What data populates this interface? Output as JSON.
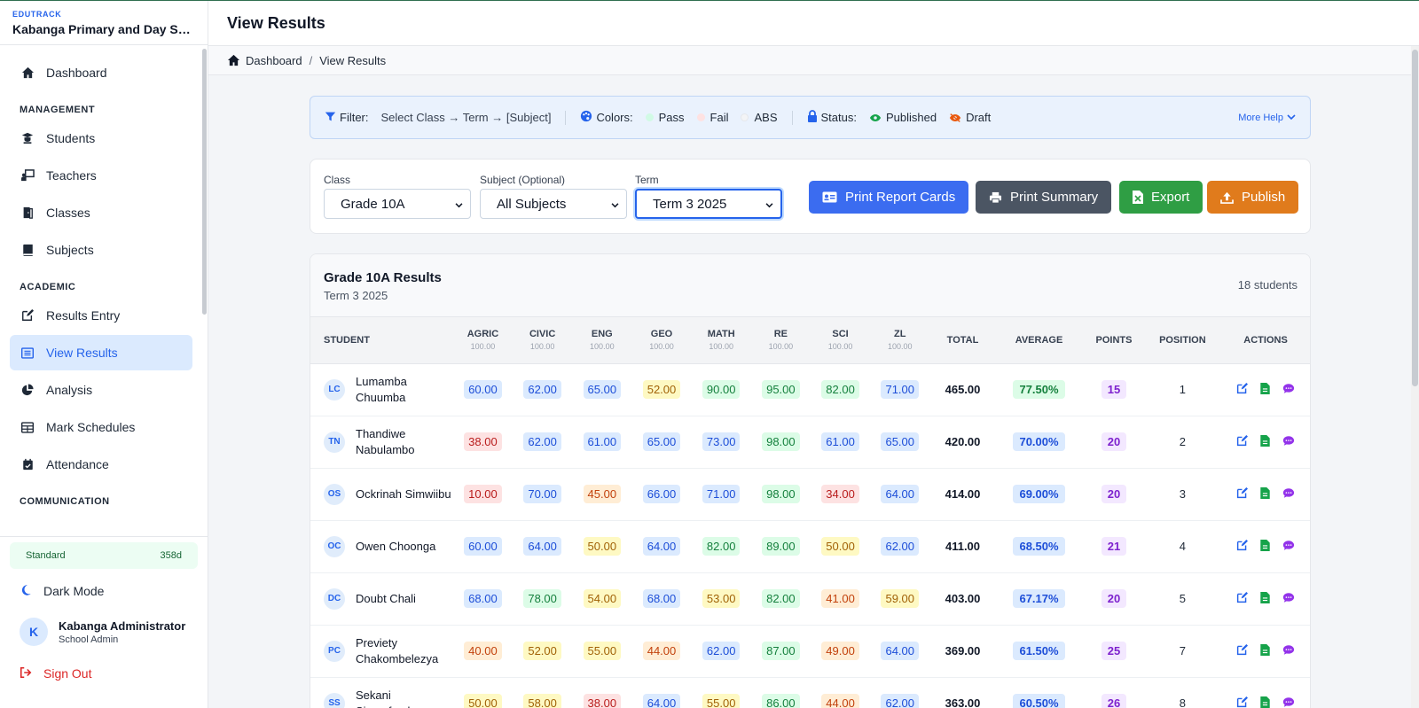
{
  "brand": {
    "tag": "EDUTRACK",
    "school": "Kabanga Primary and Day Sec..."
  },
  "sidebar": {
    "items_top": [
      {
        "label": "Dashboard",
        "icon": "home-icon"
      }
    ],
    "section_management": "MANAGEMENT",
    "items_management": [
      {
        "label": "Students",
        "icon": "student-icon"
      },
      {
        "label": "Teachers",
        "icon": "teacher-icon"
      },
      {
        "label": "Classes",
        "icon": "door-icon"
      },
      {
        "label": "Subjects",
        "icon": "book-icon"
      }
    ],
    "section_academic": "ACADEMIC",
    "items_academic": [
      {
        "label": "Results Entry",
        "icon": "edit-icon"
      },
      {
        "label": "View Results",
        "icon": "list-icon",
        "active": true
      },
      {
        "label": "Analysis",
        "icon": "pie-chart-icon"
      },
      {
        "label": "Mark Schedules",
        "icon": "table-icon"
      },
      {
        "label": "Attendance",
        "icon": "calendar-check-icon"
      }
    ],
    "section_communication": "COMMUNICATION",
    "plan": {
      "name": "Standard",
      "days": "358d"
    },
    "dark_mode": "Dark Mode",
    "user": {
      "initial": "K",
      "name": "Kabanga Administrator",
      "role": "School Admin"
    },
    "sign_out": "Sign Out"
  },
  "header": {
    "title": "View Results"
  },
  "breadcrumb": {
    "home": "Dashboard",
    "current": "View Results"
  },
  "help": {
    "filter_label": "Filter:",
    "filter_text": "Select Class → Term → [Subject]",
    "colors_label": "Colors:",
    "pass": "Pass",
    "fail": "Fail",
    "abs": "ABS",
    "status_label": "Status:",
    "published": "Published",
    "draft": "Draft",
    "more_help": "More Help"
  },
  "filters": {
    "class_label": "Class",
    "class_value": "Grade 10A",
    "subject_label": "Subject (Optional)",
    "subject_value": "All Subjects",
    "term_label": "Term",
    "term_value": "Term 3 2025"
  },
  "buttons": {
    "print_report": "Print Report Cards",
    "print_summary": "Print Summary",
    "export": "Export",
    "publish": "Publish"
  },
  "colors": {
    "blue_btn": "#3b6cf0",
    "gray_btn": "#4b5563",
    "green_btn": "#2f9e44",
    "orange_btn": "#e07b1c"
  },
  "results": {
    "title": "Grade 10A Results",
    "term": "Term 3 2025",
    "count": "18 students",
    "columns": {
      "student": "STUDENT",
      "subjects": [
        "AGRIC",
        "CIVIC",
        "ENG",
        "GEO",
        "MATH",
        "RE",
        "SCI",
        "ZL"
      ],
      "max": "100.00",
      "total": "TOTAL",
      "average": "AVERAGE",
      "points": "POINTS",
      "position": "POSITION",
      "actions": "ACTIONS"
    },
    "rows": [
      {
        "initials": "LC",
        "name": "Lumamba Chuumba",
        "marks": [
          "60.00",
          "62.00",
          "65.00",
          "52.00",
          "90.00",
          "95.00",
          "82.00",
          "71.00"
        ],
        "total": "465.00",
        "average": "77.50%",
        "points": "15",
        "position": "1"
      },
      {
        "initials": "TN",
        "name": "Thandiwe Nabulambo",
        "marks": [
          "38.00",
          "62.00",
          "61.00",
          "65.00",
          "73.00",
          "98.00",
          "61.00",
          "65.00"
        ],
        "total": "420.00",
        "average": "70.00%",
        "points": "20",
        "position": "2"
      },
      {
        "initials": "OS",
        "name": "Ockrinah Simwiibu",
        "marks": [
          "10.00",
          "70.00",
          "45.00",
          "66.00",
          "71.00",
          "98.00",
          "34.00",
          "64.00"
        ],
        "total": "414.00",
        "average": "69.00%",
        "points": "20",
        "position": "3"
      },
      {
        "initials": "OC",
        "name": "Owen Choonga",
        "marks": [
          "60.00",
          "64.00",
          "50.00",
          "64.00",
          "82.00",
          "89.00",
          "50.00",
          "62.00"
        ],
        "total": "411.00",
        "average": "68.50%",
        "points": "21",
        "position": "4"
      },
      {
        "initials": "DC",
        "name": "Doubt Chali",
        "marks": [
          "68.00",
          "78.00",
          "54.00",
          "68.00",
          "53.00",
          "82.00",
          "41.00",
          "59.00"
        ],
        "total": "403.00",
        "average": "67.17%",
        "points": "20",
        "position": "5"
      },
      {
        "initials": "PC",
        "name": "Previety Chakombelezya",
        "marks": [
          "40.00",
          "52.00",
          "55.00",
          "44.00",
          "62.00",
          "87.00",
          "49.00",
          "64.00"
        ],
        "total": "369.00",
        "average": "61.50%",
        "points": "25",
        "position": "7"
      },
      {
        "initials": "SS",
        "name": "Sekani Siamafumba",
        "marks": [
          "50.00",
          "58.00",
          "38.00",
          "64.00",
          "55.00",
          "86.00",
          "44.00",
          "62.00"
        ],
        "total": "363.00",
        "average": "60.50%",
        "points": "26",
        "position": "8"
      }
    ]
  }
}
